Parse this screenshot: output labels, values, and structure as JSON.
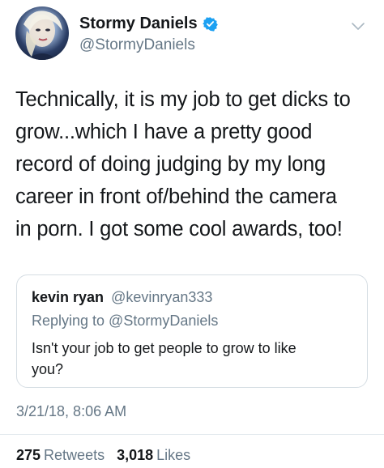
{
  "tweet": {
    "author": {
      "display_name": "Stormy Daniels",
      "handle": "@StormyDaniels",
      "verified": true
    },
    "text_lines": [
      "Technically, it is my job to get dicks to",
      "grow...which I have a pretty good",
      "record of doing judging by my long",
      "career in front of/behind the camera",
      "in porn. I got some cool awards, too!"
    ],
    "quoted": {
      "author_name": "kevin ryan",
      "author_handle": "@kevinryan333",
      "replying_to": "Replying to @StormyDaniels",
      "text_lines": [
        "Isn't your job to get people to grow to like",
        "you?"
      ]
    },
    "timestamp": "3/21/18, 8:06 AM",
    "stats": {
      "retweets_count": "275",
      "retweets_label": "Retweets",
      "likes_count": "3,018",
      "likes_label": "Likes"
    }
  },
  "colors": {
    "text_primary": "#14171a",
    "text_secondary": "#657786",
    "verified_blue": "#1da1f2",
    "border": "#e1e8ed"
  },
  "icons": {
    "verified": "verified-badge-icon",
    "menu": "chevron-down-icon"
  }
}
